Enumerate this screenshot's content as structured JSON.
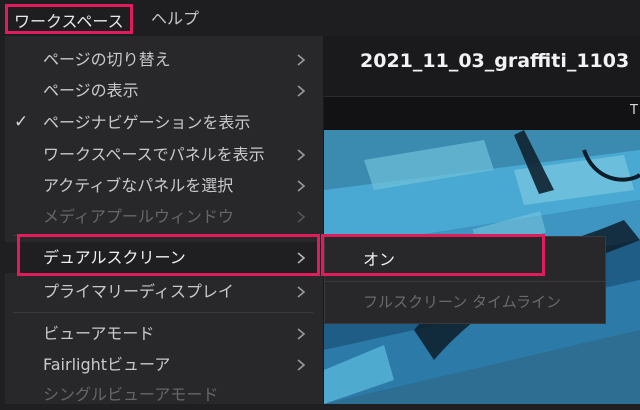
{
  "menubar": {
    "workspace": "ワークスペース",
    "help": "ヘルプ"
  },
  "document": {
    "title": "2021_11_03_graffiti_1103",
    "tab_indicator": "T"
  },
  "workspace_menu": {
    "items": [
      {
        "label": "ページの切り替え",
        "has_submenu": true,
        "enabled": true
      },
      {
        "label": "ページの表示",
        "has_submenu": true,
        "enabled": true
      },
      {
        "label": "ページナビゲーションを表示",
        "checked": true,
        "enabled": true
      },
      {
        "label": "ワークスペースでパネルを表示",
        "has_submenu": true,
        "enabled": true
      },
      {
        "label": "アクティブなパネルを選択",
        "has_submenu": true,
        "enabled": true
      },
      {
        "label": "メディアプールウィンドウ",
        "has_submenu": true,
        "enabled": false
      },
      {
        "label": "デュアルスクリーン",
        "has_submenu": true,
        "enabled": true,
        "active": true
      },
      {
        "label": "プライマリーディスプレイ",
        "has_submenu": true,
        "enabled": true
      },
      {
        "label": "ビューアモード",
        "has_submenu": true,
        "enabled": true
      },
      {
        "label": "Fairlightビューア",
        "has_submenu": true,
        "enabled": true
      },
      {
        "label": "シングルビューアモード",
        "enabled": false
      }
    ]
  },
  "dual_screen_submenu": {
    "items": [
      {
        "label": "オン",
        "enabled": true
      },
      {
        "label": "フルスクリーン タイムライン",
        "enabled": false
      }
    ]
  },
  "colors": {
    "highlight": "#e01c5c",
    "menu_bg": "#28282b",
    "menubar_bg": "#1e1e21"
  }
}
